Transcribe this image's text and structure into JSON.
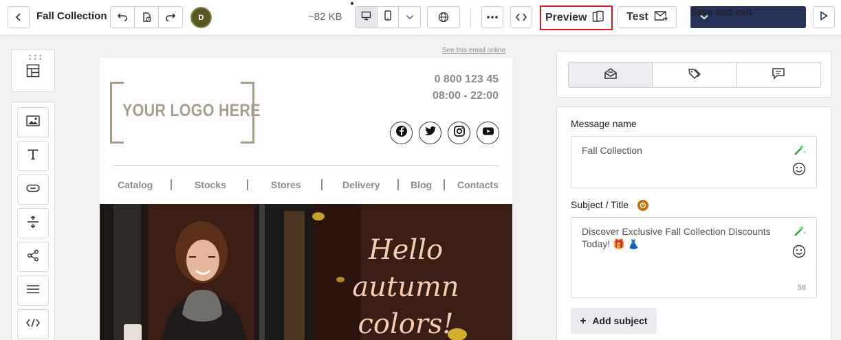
{
  "header": {
    "title": "Fall Collection",
    "avatar_initial": "D",
    "size": "~82 KB",
    "preview_label": "Preview",
    "test_label": "Test",
    "save_label": "Save and exit"
  },
  "toolbar": {
    "icons": [
      "back-icon",
      "undo-icon",
      "history-icon",
      "redo-icon",
      "desktop-icon",
      "mobile-icon",
      "chevron-down-icon",
      "globe-icon",
      "more-icon",
      "code-icon",
      "device-preview-icon",
      "envelope-send-icon",
      "play-icon"
    ]
  },
  "tools": {
    "icons": [
      "layout-icon",
      "image-icon",
      "text-icon",
      "button-icon",
      "spacer-icon",
      "share-icon",
      "divider-icon",
      "html-code-icon"
    ]
  },
  "email": {
    "see_online": "See this email online",
    "logo_text": "YOUR LOGO HERE",
    "phone": "0 800 123 45",
    "hours": "08:00 - 22:00",
    "social": [
      "facebook-icon",
      "twitter-icon",
      "instagram-icon",
      "youtube-icon"
    ],
    "nav": [
      "Catalog",
      "Stocks",
      "Stores",
      "Delivery",
      "Blog",
      "Contacts"
    ],
    "hero_lines": [
      "Hello",
      "autumn",
      "colors!"
    ]
  },
  "panel": {
    "tabs": [
      "envelope-settings-icon",
      "tags-icon",
      "comments-icon"
    ],
    "message_name_label": "Message name",
    "message_name_value": "Fall Collection",
    "subject_label": "Subject / Title",
    "subject_value": "Discover Exclusive Fall Collection Discounts Today! 🎁 👗",
    "subject_count": "56",
    "add_subject_label": "Add subject"
  },
  "colors": {
    "primary": "#253158",
    "highlight": "#e0141e",
    "hero_bg": "#3a1e14",
    "hero_text": "#f6cdb4",
    "logo": "#a79e8a"
  }
}
